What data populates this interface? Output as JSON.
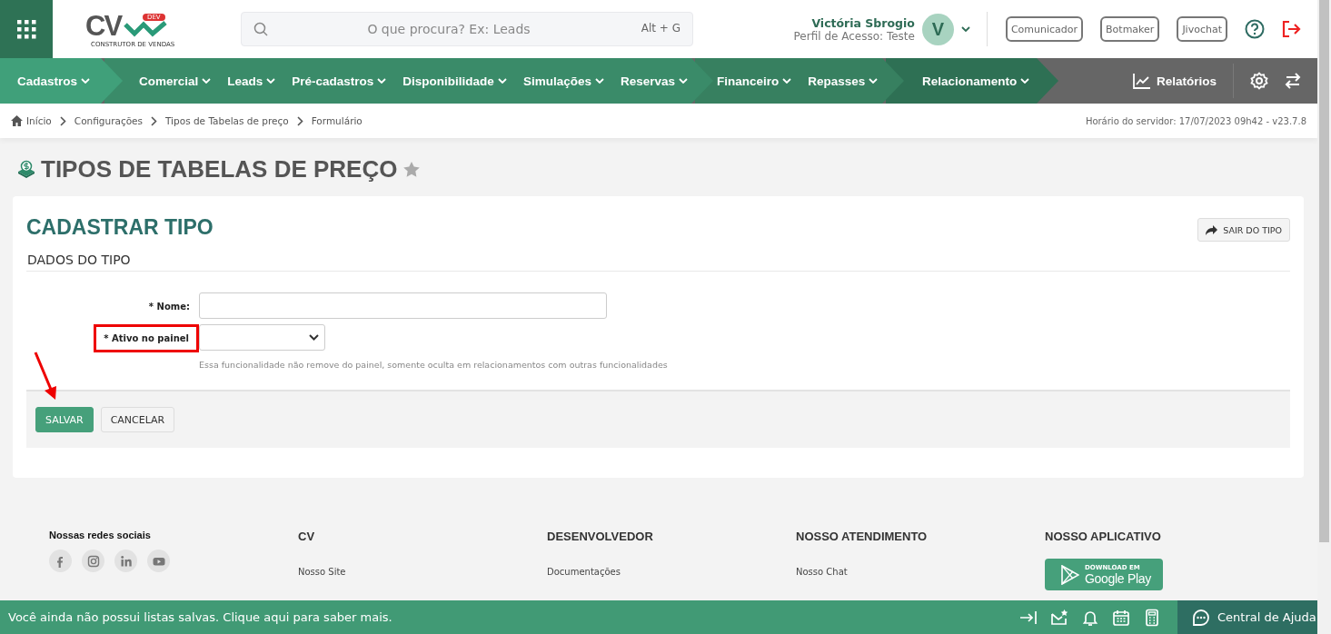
{
  "header": {
    "logo": {
      "mark": "CV",
      "badge": "DEV",
      "tagline": "CONSTRUTOR DE VENDAS"
    },
    "search": {
      "placeholder": "O que procura? Ex: Leads",
      "shortcut": "Alt + G"
    },
    "user": {
      "name": "Victória Sbrogio",
      "profile": "Perfil de Acesso: Teste",
      "initial": "V"
    },
    "buttons": [
      "Comunicador",
      "Botmaker",
      "Jivochat"
    ]
  },
  "nav": {
    "groups": [
      {
        "items": [
          "Cadastros"
        ]
      },
      {
        "items": [
          "Comercial",
          "Leads",
          "Pré-cadastros",
          "Disponibilidade",
          "Simulações",
          "Reservas"
        ]
      },
      {
        "items": [
          "Financeiro",
          "Repasses"
        ]
      },
      {
        "items": [
          "Relacionamento"
        ]
      }
    ],
    "reports": "Relatórios"
  },
  "breadcrumb": {
    "items": [
      "Início",
      "Configurações",
      "Tipos de Tabelas de preço",
      "Formulário"
    ],
    "server_time": "Horário do servidor: 17/07/2023 09h42 - v23.7.8"
  },
  "page": {
    "title": "TIPOS DE TABELAS DE PREÇO",
    "favorite": false
  },
  "form": {
    "title": "CADASTRAR TIPO",
    "exit_button": "SAIR DO TIPO",
    "section": "DADOS DO TIPO",
    "fields": [
      {
        "kind": "text",
        "label": "* Nome:",
        "highlighted": false
      },
      {
        "kind": "select",
        "label": "* Ativo no painel",
        "highlighted": true,
        "hint": "Essa funcionalidade não remove do painel, somente oculta em relacionamentos com outras funcionalidades"
      }
    ],
    "actions": [
      {
        "kind": "primary",
        "label": "SALVAR",
        "annotated": true
      },
      {
        "kind": "default",
        "label": "CANCELAR",
        "annotated": false
      }
    ]
  },
  "footer": {
    "columns": [
      {
        "kind": "social",
        "title": "Nossas redes sociais",
        "icons": [
          {
            "kind": "facebook"
          },
          {
            "kind": "instagram"
          },
          {
            "kind": "linkedin"
          },
          {
            "kind": "youtube"
          }
        ]
      },
      {
        "kind": "links",
        "title": "CV",
        "links": [
          "Nosso Site"
        ]
      },
      {
        "kind": "links",
        "title": "DESENVOLVEDOR",
        "links": [
          "Documentações"
        ]
      },
      {
        "kind": "links",
        "title": "NOSSO ATENDIMENTO",
        "links": [
          "Nosso Chat"
        ]
      },
      {
        "kind": "app",
        "title": "NOSSO APLICATIVO",
        "store": {
          "small": "DOWNLOAD EM",
          "large": "Google Play"
        }
      }
    ]
  },
  "status_bar": {
    "message": "Você ainda não possui listas salvas. Clique aqui para saber mais.",
    "icons": [
      {
        "kind": "collapse"
      },
      {
        "kind": "mail"
      },
      {
        "kind": "bell"
      },
      {
        "kind": "calendar"
      },
      {
        "kind": "calculator"
      }
    ],
    "help": "Central de Ajuda"
  }
}
